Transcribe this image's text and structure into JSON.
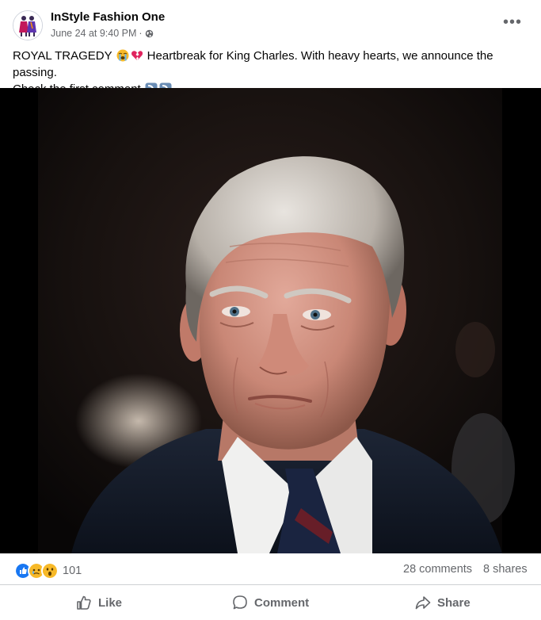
{
  "post": {
    "page_name": "InStyle Fashion One",
    "timestamp": "June 24 at 9:40 PM",
    "separator": "·",
    "audience_icon": "globe-icon",
    "more_icon": "more-options-icon",
    "more_label": "•••",
    "caption_line1_a": "ROYAL TRAGEDY",
    "caption_emojis_1": [
      "loudly-crying-face-emoji",
      "broken-heart-emoji"
    ],
    "caption_line1_b": "Heartbreak for King Charles. With heavy hearts, we announce the passing.",
    "caption_line2": "Check the first comment",
    "caption_emojis_2": [
      "down-right-arrow-emoji",
      "down-right-arrow-emoji"
    ]
  },
  "engagement": {
    "reaction_icons": [
      "like-reaction-icon",
      "sad-reaction-icon",
      "wow-reaction-icon"
    ],
    "reaction_count": "101",
    "comments": "28 comments",
    "shares": "8 shares"
  },
  "actions": {
    "like_label": "Like",
    "comment_label": "Comment",
    "share_label": "Share"
  },
  "colors": {
    "text_primary": "#050505",
    "text_secondary": "#65676b",
    "like_blue": "#1877f2",
    "reaction_yellow": "#f7b928",
    "divider": "#ced0d4"
  }
}
